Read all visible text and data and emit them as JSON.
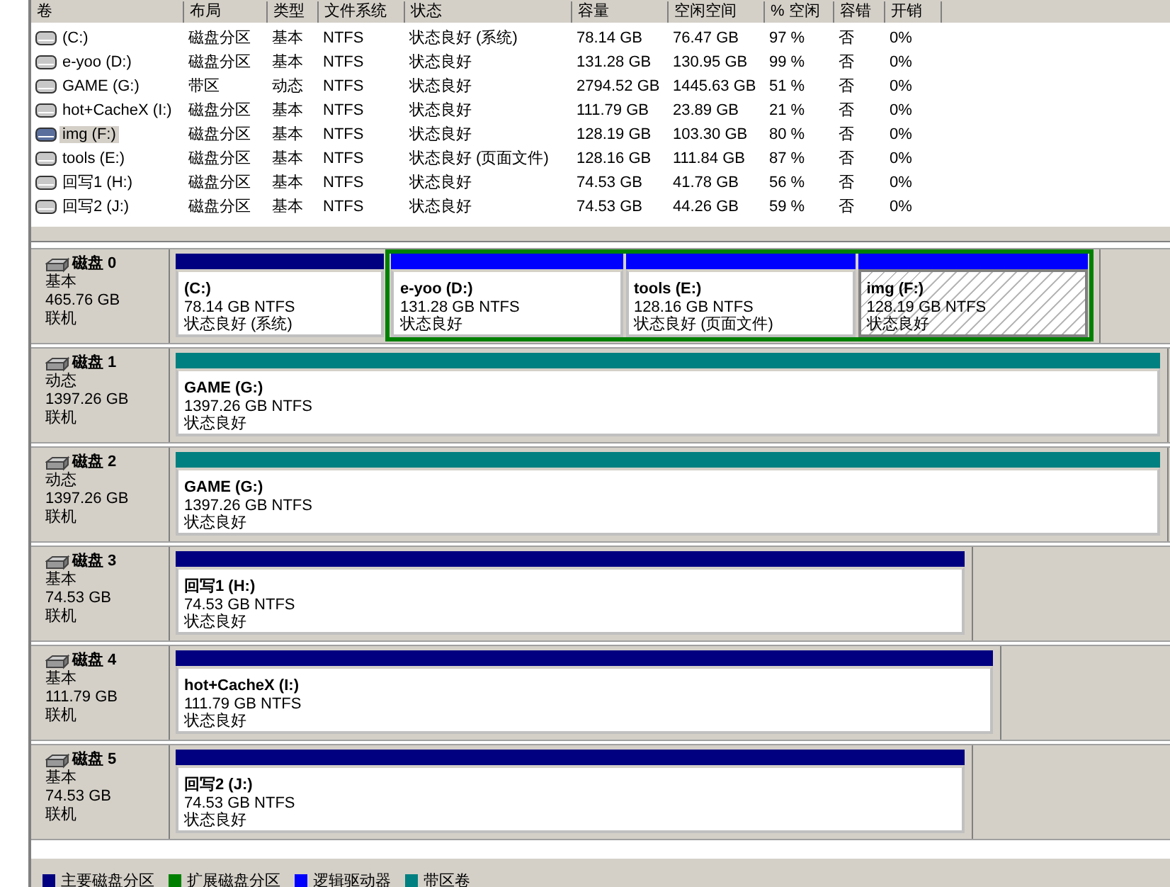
{
  "volumes": {
    "columns": [
      "卷",
      "布局",
      "类型",
      "文件系统",
      "状态",
      "容量",
      "空闲空间",
      "% 空闲",
      "容错",
      "开销"
    ],
    "rows": [
      {
        "name": "(C:)",
        "layout": "磁盘分区",
        "type": "基本",
        "fs": "NTFS",
        "status": "状态良好 (系统)",
        "capacity": "78.14 GB",
        "free": "76.47 GB",
        "free_pct": "97 %",
        "fault_tolerance": "否",
        "overhead": "0%",
        "selected": false
      },
      {
        "name": "e-yoo (D:)",
        "layout": "磁盘分区",
        "type": "基本",
        "fs": "NTFS",
        "status": "状态良好",
        "capacity": "131.28 GB",
        "free": "130.95 GB",
        "free_pct": "99 %",
        "fault_tolerance": "否",
        "overhead": "0%",
        "selected": false
      },
      {
        "name": "GAME (G:)",
        "layout": "带区",
        "type": "动态",
        "fs": "NTFS",
        "status": "状态良好",
        "capacity": "2794.52 GB",
        "free": "1445.63 GB",
        "free_pct": "51 %",
        "fault_tolerance": "否",
        "overhead": "0%",
        "selected": false
      },
      {
        "name": "hot+CacheX (I:)",
        "layout": "磁盘分区",
        "type": "基本",
        "fs": "NTFS",
        "status": "状态良好",
        "capacity": "111.79 GB",
        "free": "23.89 GB",
        "free_pct": "21 %",
        "fault_tolerance": "否",
        "overhead": "0%",
        "selected": false
      },
      {
        "name": "img (F:)",
        "layout": "磁盘分区",
        "type": "基本",
        "fs": "NTFS",
        "status": "状态良好",
        "capacity": "128.19 GB",
        "free": "103.30 GB",
        "free_pct": "80 %",
        "fault_tolerance": "否",
        "overhead": "0%",
        "selected": true
      },
      {
        "name": "tools (E:)",
        "layout": "磁盘分区",
        "type": "基本",
        "fs": "NTFS",
        "status": "状态良好 (页面文件)",
        "capacity": "128.16 GB",
        "free": "111.84 GB",
        "free_pct": "87 %",
        "fault_tolerance": "否",
        "overhead": "0%",
        "selected": false
      },
      {
        "name": "回写1 (H:)",
        "layout": "磁盘分区",
        "type": "基本",
        "fs": "NTFS",
        "status": "状态良好",
        "capacity": "74.53 GB",
        "free": "41.78 GB",
        "free_pct": "56 %",
        "fault_tolerance": "否",
        "overhead": "0%",
        "selected": false
      },
      {
        "name": "回写2 (J:)",
        "layout": "磁盘分区",
        "type": "基本",
        "fs": "NTFS",
        "status": "状态良好",
        "capacity": "74.53 GB",
        "free": "44.26 GB",
        "free_pct": "59 %",
        "fault_tolerance": "否",
        "overhead": "0%",
        "selected": false
      }
    ]
  },
  "disks": [
    {
      "label": "磁盘 0",
      "type": "基本",
      "size": "465.76 GB",
      "status": "联机",
      "partitions": [
        {
          "kind": "primary",
          "name": "(C:)",
          "size": "78.14 GB NTFS",
          "status": "状态良好 (系统)",
          "selected": false
        },
        {
          "kind": "extended",
          "children": [
            {
              "kind": "logical",
              "name": "e-yoo (D:)",
              "size": "131.28 GB NTFS",
              "status": "状态良好",
              "selected": false
            },
            {
              "kind": "logical",
              "name": "tools (E:)",
              "size": "128.16 GB NTFS",
              "status": "状态良好 (页面文件)",
              "selected": false
            },
            {
              "kind": "logical",
              "name": "img (F:)",
              "size": "128.19 GB NTFS",
              "status": "状态良好",
              "selected": true
            }
          ]
        }
      ]
    },
    {
      "label": "磁盘 1",
      "type": "动态",
      "size": "1397.26 GB",
      "status": "联机",
      "partitions": [
        {
          "kind": "striped",
          "name": "GAME (G:)",
          "size": "1397.26 GB NTFS",
          "status": "状态良好",
          "selected": false
        }
      ]
    },
    {
      "label": "磁盘 2",
      "type": "动态",
      "size": "1397.26 GB",
      "status": "联机",
      "partitions": [
        {
          "kind": "striped",
          "name": "GAME (G:)",
          "size": "1397.26 GB NTFS",
          "status": "状态良好",
          "selected": false
        }
      ]
    },
    {
      "label": "磁盘 3",
      "type": "基本",
      "size": "74.53 GB",
      "status": "联机",
      "partitions": [
        {
          "kind": "primary",
          "name": "回写1 (H:)",
          "size": "74.53 GB NTFS",
          "status": "状态良好",
          "selected": false
        }
      ]
    },
    {
      "label": "磁盘 4",
      "type": "基本",
      "size": "111.79 GB",
      "status": "联机",
      "partitions": [
        {
          "kind": "primary",
          "name": "hot+CacheX (I:)",
          "size": "111.79 GB NTFS",
          "status": "状态良好",
          "selected": false
        }
      ]
    },
    {
      "label": "磁盘 5",
      "type": "基本",
      "size": "74.53 GB",
      "status": "联机",
      "partitions": [
        {
          "kind": "primary",
          "name": "回写2 (J:)",
          "size": "74.53 GB NTFS",
          "status": "状态良好",
          "selected": false
        }
      ]
    }
  ],
  "legend": [
    {
      "label": "主要磁盘分区",
      "color": "#000080"
    },
    {
      "label": "扩展磁盘分区",
      "color": "#008000"
    },
    {
      "label": "逻辑驱动器",
      "color": "#0000ff"
    },
    {
      "label": "带区卷",
      "color": "#008080"
    }
  ]
}
